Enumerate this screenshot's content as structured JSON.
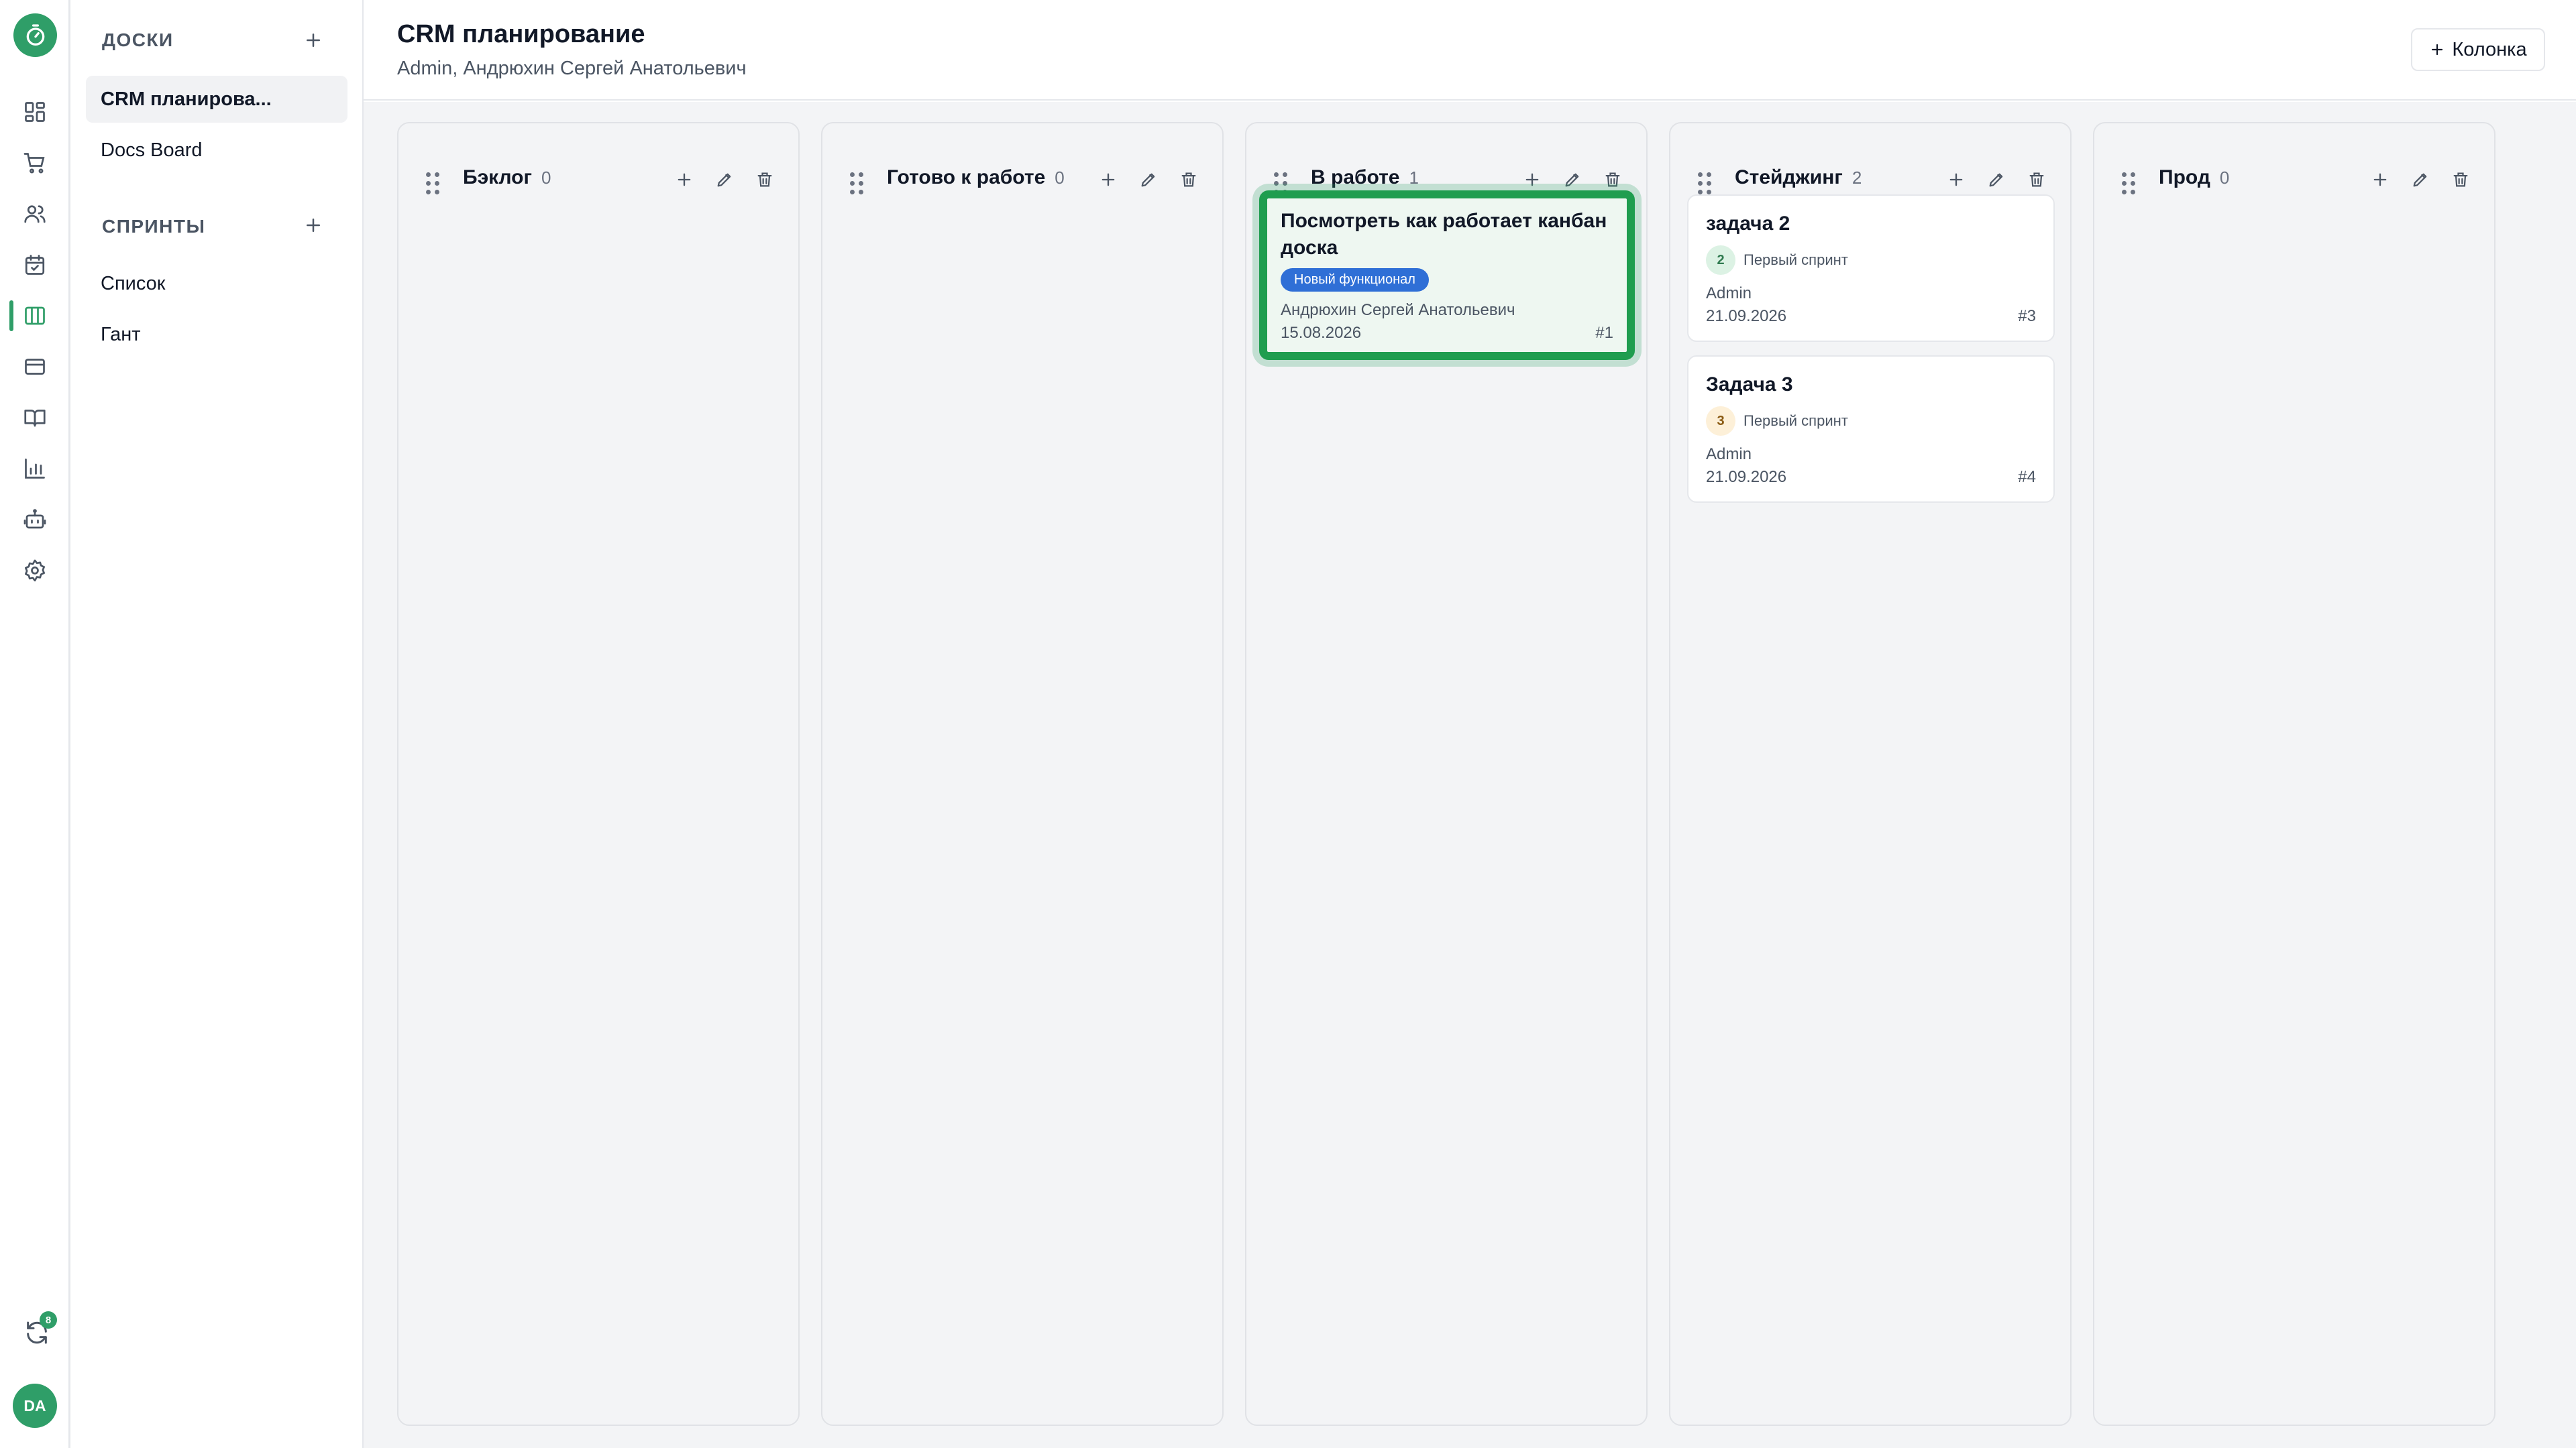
{
  "sidebar": {
    "boards_title": "ДОСКИ",
    "boards": [
      {
        "label": "CRM планирова..."
      },
      {
        "label": "Docs Board"
      }
    ],
    "sprints_title": "СПРИНТЫ",
    "views": [
      {
        "label": "Список"
      },
      {
        "label": "Гант"
      }
    ]
  },
  "rail": {
    "sync_badge": "8",
    "avatar_initials": "DA",
    "accent": "#2f9e68"
  },
  "header": {
    "title": "CRM планирование",
    "subtitle": "Admin, Андрюхин Сергей Анатольевич",
    "add_column_label": "Колонка"
  },
  "columns": [
    {
      "title": "Бэклог",
      "count": "0",
      "cards": []
    },
    {
      "title": "Готово к работе",
      "count": "0",
      "cards": []
    },
    {
      "title": "В работе",
      "count": "1",
      "cards": [
        {
          "title": "Посмотреть как работает канбан доска",
          "tag": "Новый функционал",
          "assignee": "Андрюхин Сергей Анатольевич",
          "date": "15.08.2026",
          "id": "#1"
        }
      ]
    },
    {
      "title": "Стейджинг",
      "count": "2",
      "cards": [
        {
          "title": "задача 2",
          "sprint_no": "2",
          "sprint": "Первый спринт",
          "assignee": "Admin",
          "date": "21.09.2026",
          "id": "#3"
        },
        {
          "title": "Задача 3",
          "sprint_no": "3",
          "sprint": "Первый спринт",
          "assignee": "Admin",
          "date": "21.09.2026",
          "id": "#4"
        }
      ]
    },
    {
      "title": "Прод",
      "count": "0",
      "cards": []
    }
  ],
  "colors": {
    "highlight_border": "#1f9d4f",
    "tag_bg": "#2f6fd6",
    "sprint2_bg": "#dcf2e4",
    "sprint3_bg": "#fdf0d8"
  }
}
